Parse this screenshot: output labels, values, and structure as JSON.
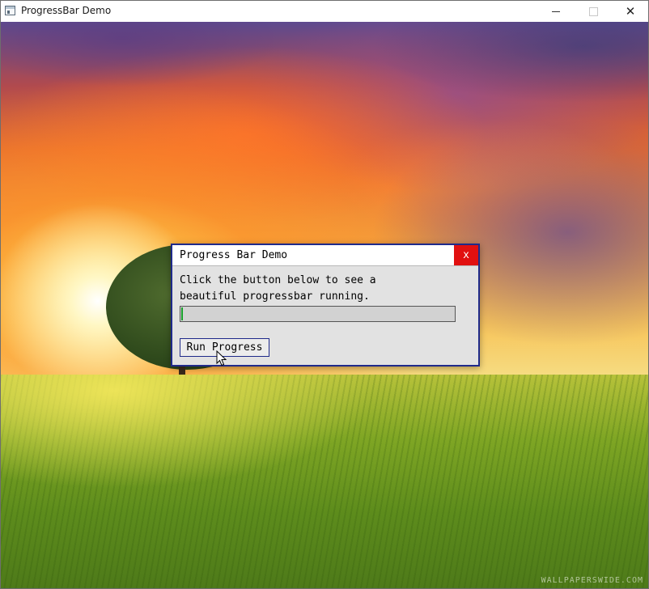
{
  "window": {
    "title": "ProgressBar Demo",
    "controls": {
      "minimize_icon": "minimize-icon",
      "maximize_icon": "maximize-icon",
      "close_label": "✕"
    }
  },
  "background": {
    "watermark": "WALLPAPERSWIDE.COM"
  },
  "dialog": {
    "title": "Progress Bar Demo",
    "close_label": "x",
    "message": "Click the button below to see a\nbeautiful progressbar running.",
    "progress": {
      "value": 0.005,
      "fill_color": "#17a02a"
    },
    "button_label": "Run Progress"
  },
  "colors": {
    "dialog_border": "#1f2a8a",
    "close_button": "#e11010"
  }
}
